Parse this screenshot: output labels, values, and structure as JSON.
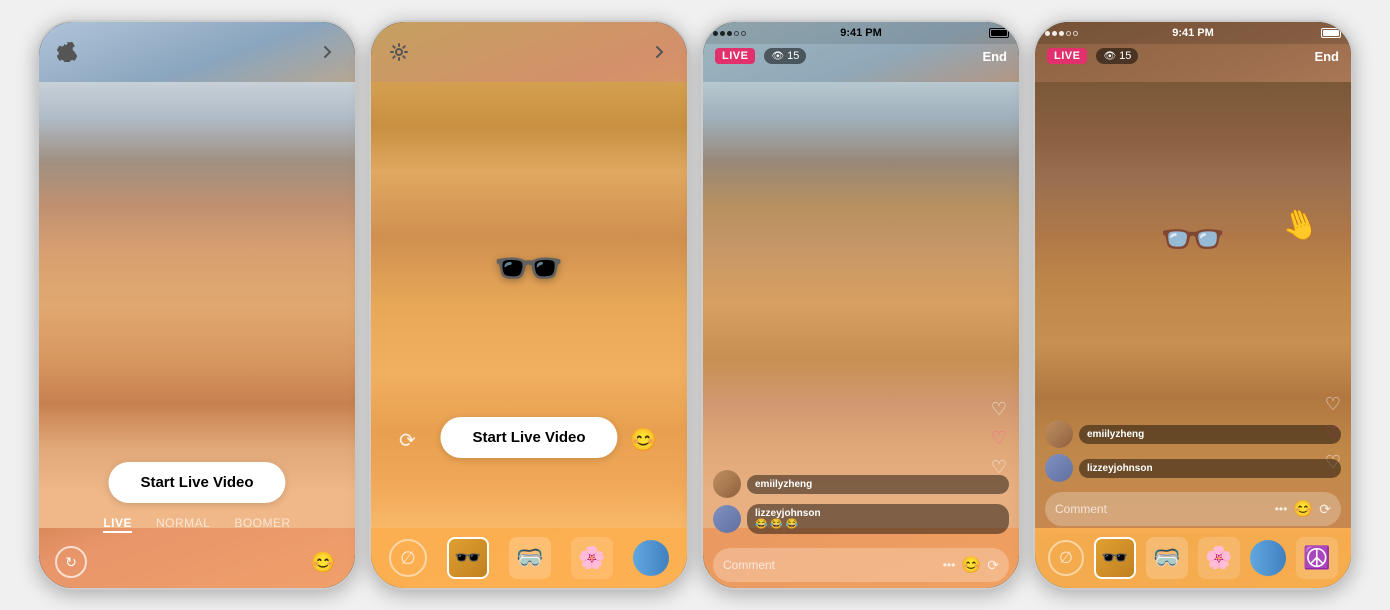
{
  "phones": [
    {
      "id": "phone1",
      "type": "pre-live",
      "statusBar": {
        "visible": false
      },
      "topControls": {
        "leftIcon": "gear",
        "rightIcon": "chevron-right"
      },
      "startLiveButton": "Start Live Video",
      "bottomTabs": [
        {
          "label": "LIVE",
          "active": true
        },
        {
          "label": "NORMAL",
          "active": false
        },
        {
          "label": "BOOMER",
          "active": false
        }
      ],
      "showFilterStrip": false
    },
    {
      "id": "phone2",
      "type": "pre-live-filters",
      "statusBar": {
        "visible": false
      },
      "topControls": {
        "leftIcon": "gear",
        "rightIcon": "chevron-right"
      },
      "startLiveButton": "Start Live Video",
      "filters": [
        "none",
        "sunglasses",
        "redgoggles",
        "flower",
        "blue"
      ],
      "selectedFilter": 1,
      "showFilterStrip": true,
      "hasGlasses": true
    },
    {
      "id": "phone3",
      "type": "live",
      "statusBar": {
        "visible": true,
        "time": "9:41 PM",
        "signalDots": "●●●○○",
        "batteryFull": true
      },
      "topControls": {
        "liveBadge": "LIVE",
        "viewerCount": "15",
        "viewerIcon": "eye",
        "endLabel": "End"
      },
      "comments": [
        {
          "username": "emiilyzheng",
          "text": ""
        },
        {
          "username": "lizzeyjohnson",
          "text": "😂😂😂"
        }
      ],
      "commentPlaceholder": "Comment",
      "hearts": [
        "♡",
        "♡",
        "♡"
      ],
      "showFilterStrip": false
    },
    {
      "id": "phone4",
      "type": "live-filters",
      "statusBar": {
        "visible": true,
        "time": "9:41 PM",
        "signalDots": "●●●○○",
        "batteryFull": true
      },
      "topControls": {
        "liveBadge": "LIVE",
        "viewerCount": "15",
        "viewerIcon": "eye",
        "endLabel": "End"
      },
      "comments": [
        {
          "username": "emiilyzheng",
          "text": ""
        },
        {
          "username": "lizzeyjohnson",
          "text": ""
        }
      ],
      "commentPlaceholder": "Comment",
      "hearts": [
        "♡",
        "♡"
      ],
      "showFilterStrip": true,
      "hasGlasses": true,
      "filters": [
        "none",
        "sunglasses",
        "redgoggles",
        "flower",
        "blue",
        "peace"
      ],
      "selectedFilter": 1
    }
  ]
}
